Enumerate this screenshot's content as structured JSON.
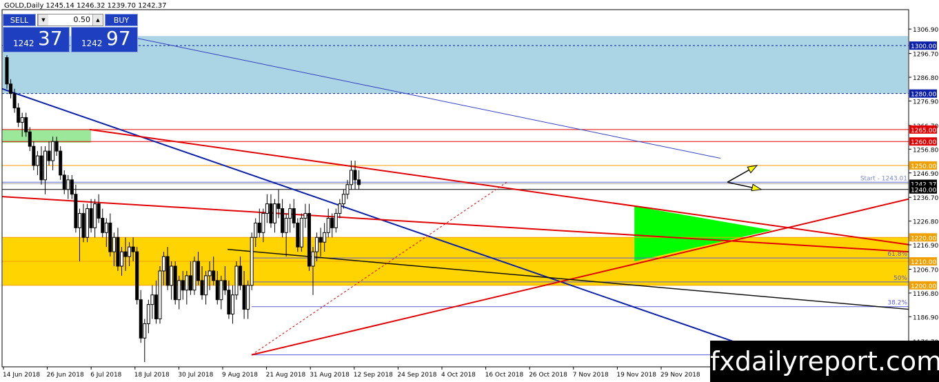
{
  "header": {
    "title": "GOLD,Daily  1245.14 1246.32 1239.70 1242.37"
  },
  "trade_panel": {
    "sell_label": "SELL",
    "buy_label": "BUY",
    "lot": "0.50",
    "sell_small": "1242",
    "sell_big": "37",
    "buy_small": "1242",
    "buy_big": "97"
  },
  "watermark": "fxdailyreport.com",
  "chart_data": {
    "type": "candlestick",
    "symbol": "GOLD",
    "timeframe": "Daily",
    "ohlc_header": [
      1245.14,
      1246.32,
      1239.7,
      1242.37
    ],
    "y_ticks": [
      "1306.90",
      "1296.70",
      "1286.80",
      "1276.90",
      "1266.70",
      "1256.80",
      "1246.90",
      "1236.70",
      "1226.80",
      "1216.90",
      "1206.70",
      "1196.80",
      "1186.90",
      "1176.70"
    ],
    "x_labels": [
      "14 Jun 2018",
      "26 Jun 2018",
      "6 Jul 2018",
      "18 Jul 2018",
      "30 Jul 2018",
      "9 Aug 2018",
      "21 Aug 2018",
      "31 Aug 2018",
      "12 Sep 2018",
      "24 Sep 2018",
      "4 Oct 2018",
      "16 Oct 2018",
      "26 Oct 2018",
      "7 Nov 2018",
      "19 Nov 2018",
      "29 Nov 2018"
    ],
    "ylim": [
      1166,
      1315
    ],
    "price_tags": [
      {
        "value": 1300.0,
        "label": "1300.00",
        "color": "#0a1fa8"
      },
      {
        "value": 1280.0,
        "label": "1280.00",
        "color": "#0a1fa8"
      },
      {
        "value": 1265.0,
        "label": "1265.00",
        "color": "#e00000"
      },
      {
        "value": 1260.0,
        "label": "1260.00",
        "color": "#e00000"
      },
      {
        "value": 1250.0,
        "label": "1250.00",
        "color": "#f0a000"
      },
      {
        "value": 1242.37,
        "label": "1242.37",
        "color": "#000000"
      },
      {
        "value": 1240.0,
        "label": "1240.00",
        "color": "#000000"
      },
      {
        "value": 1220.0,
        "label": "1220.00",
        "color": "#f0a000"
      },
      {
        "value": 1210.0,
        "label": "1210.00",
        "color": "#f0a000"
      },
      {
        "value": 1200.0,
        "label": "1200.00",
        "color": "#f0a000"
      }
    ],
    "zones": [
      {
        "name": "resistance-zone",
        "from": 1280,
        "to": 1304,
        "color": "#abd4e4"
      },
      {
        "name": "support-zone",
        "from": 1200,
        "to": 1220,
        "color": "#ffd400"
      }
    ],
    "fib_levels": [
      {
        "label": "61.8%",
        "value": 1211.4
      },
      {
        "label": "50%",
        "value": 1201.4
      },
      {
        "label": "38.2%",
        "value": 1191.1
      }
    ],
    "start_label": "Start - 1243.01",
    "start_value": 1243.01,
    "candles": [
      [
        1295,
        1296,
        1282,
        1284
      ],
      [
        1284,
        1286,
        1278,
        1280
      ],
      [
        1280,
        1282,
        1272,
        1274
      ],
      [
        1274,
        1276,
        1266,
        1268
      ],
      [
        1268,
        1272,
        1262,
        1270
      ],
      [
        1270,
        1272,
        1262,
        1264
      ],
      [
        1264,
        1266,
        1256,
        1258
      ],
      [
        1258,
        1260,
        1248,
        1250
      ],
      [
        1250,
        1256,
        1246,
        1254
      ],
      [
        1254,
        1258,
        1242,
        1244
      ],
      [
        1244,
        1258,
        1238,
        1256
      ],
      [
        1256,
        1260,
        1250,
        1252
      ],
      [
        1252,
        1262,
        1248,
        1260
      ],
      [
        1260,
        1262,
        1254,
        1256
      ],
      [
        1256,
        1258,
        1244,
        1246
      ],
      [
        1246,
        1248,
        1238,
        1240
      ],
      [
        1240,
        1246,
        1236,
        1244
      ],
      [
        1244,
        1246,
        1236,
        1238
      ],
      [
        1238,
        1242,
        1222,
        1224
      ],
      [
        1224,
        1232,
        1210,
        1230
      ],
      [
        1230,
        1234,
        1218,
        1220
      ],
      [
        1220,
        1234,
        1218,
        1232
      ],
      [
        1232,
        1236,
        1222,
        1224
      ],
      [
        1224,
        1236,
        1220,
        1234
      ],
      [
        1234,
        1238,
        1226,
        1228
      ],
      [
        1228,
        1232,
        1220,
        1222
      ],
      [
        1222,
        1228,
        1216,
        1226
      ],
      [
        1226,
        1230,
        1212,
        1214
      ],
      [
        1214,
        1222,
        1208,
        1220
      ],
      [
        1220,
        1224,
        1206,
        1208
      ],
      [
        1208,
        1216,
        1204,
        1214
      ],
      [
        1214,
        1220,
        1206,
        1212
      ],
      [
        1212,
        1218,
        1208,
        1216
      ],
      [
        1216,
        1220,
        1210,
        1214
      ],
      [
        1214,
        1216,
        1192,
        1194
      ],
      [
        1194,
        1198,
        1176,
        1178
      ],
      [
        1178,
        1186,
        1168,
        1184
      ],
      [
        1184,
        1194,
        1180,
        1192
      ],
      [
        1192,
        1200,
        1186,
        1196
      ],
      [
        1196,
        1202,
        1184,
        1186
      ],
      [
        1186,
        1208,
        1184,
        1206
      ],
      [
        1206,
        1214,
        1200,
        1212
      ],
      [
        1212,
        1216,
        1198,
        1200
      ],
      [
        1200,
        1210,
        1194,
        1208
      ],
      [
        1208,
        1210,
        1192,
        1194
      ],
      [
        1194,
        1204,
        1190,
        1202
      ],
      [
        1202,
        1206,
        1194,
        1198
      ],
      [
        1198,
        1206,
        1192,
        1204
      ],
      [
        1204,
        1210,
        1196,
        1198
      ],
      [
        1198,
        1212,
        1196,
        1210
      ],
      [
        1210,
        1214,
        1200,
        1202
      ],
      [
        1202,
        1208,
        1194,
        1196
      ],
      [
        1196,
        1206,
        1192,
        1204
      ],
      [
        1204,
        1210,
        1198,
        1206
      ],
      [
        1206,
        1212,
        1200,
        1202
      ],
      [
        1202,
        1206,
        1192,
        1194
      ],
      [
        1194,
        1204,
        1190,
        1202
      ],
      [
        1202,
        1208,
        1196,
        1198
      ],
      [
        1198,
        1202,
        1186,
        1188
      ],
      [
        1188,
        1200,
        1184,
        1196
      ],
      [
        1196,
        1210,
        1194,
        1208
      ],
      [
        1208,
        1212,
        1198,
        1200
      ],
      [
        1200,
        1206,
        1186,
        1190
      ],
      [
        1190,
        1202,
        1186,
        1200
      ],
      [
        1200,
        1222,
        1198,
        1220
      ],
      [
        1220,
        1228,
        1216,
        1226
      ],
      [
        1226,
        1232,
        1220,
        1222
      ],
      [
        1222,
        1232,
        1218,
        1230
      ],
      [
        1230,
        1238,
        1226,
        1234
      ],
      [
        1234,
        1238,
        1224,
        1226
      ],
      [
        1226,
        1236,
        1222,
        1234
      ],
      [
        1234,
        1240,
        1228,
        1232
      ],
      [
        1232,
        1236,
        1220,
        1222
      ],
      [
        1222,
        1230,
        1212,
        1228
      ],
      [
        1228,
        1234,
        1222,
        1232
      ],
      [
        1232,
        1236,
        1224,
        1226
      ],
      [
        1226,
        1228,
        1214,
        1216
      ],
      [
        1216,
        1230,
        1214,
        1228
      ],
      [
        1228,
        1234,
        1224,
        1230
      ],
      [
        1230,
        1234,
        1206,
        1208
      ],
      [
        1208,
        1216,
        1196,
        1214
      ],
      [
        1214,
        1222,
        1210,
        1220
      ],
      [
        1220,
        1224,
        1212,
        1218
      ],
      [
        1218,
        1226,
        1214,
        1222
      ],
      [
        1222,
        1232,
        1220,
        1228
      ],
      [
        1228,
        1230,
        1220,
        1224
      ],
      [
        1224,
        1232,
        1222,
        1230
      ],
      [
        1230,
        1236,
        1228,
        1234
      ],
      [
        1234,
        1240,
        1232,
        1238
      ],
      [
        1238,
        1244,
        1236,
        1242
      ],
      [
        1242,
        1252,
        1240,
        1248
      ],
      [
        1248,
        1252,
        1240,
        1244
      ],
      [
        1244,
        1248,
        1240,
        1242
      ]
    ]
  }
}
